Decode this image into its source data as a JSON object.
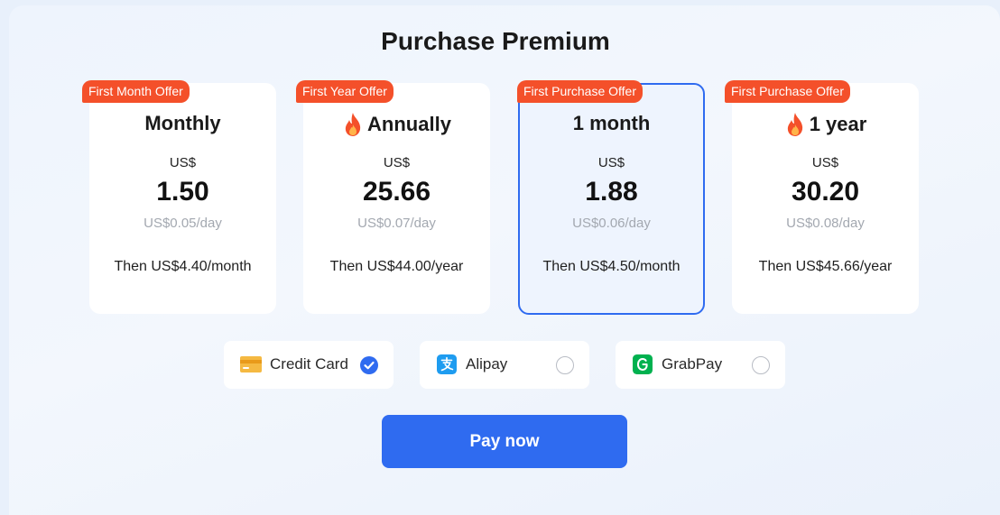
{
  "title": "Purchase Premium",
  "plans": [
    {
      "badge": "First Month Offer",
      "name": "Monthly",
      "hot": false,
      "currency": "US$",
      "price": "1.50",
      "per_day": "US$0.05/day",
      "then": "Then US$4.40/month",
      "selected": false
    },
    {
      "badge": "First Year Offer",
      "name": "Annually",
      "hot": true,
      "currency": "US$",
      "price": "25.66",
      "per_day": "US$0.07/day",
      "then": "Then US$44.00/year",
      "selected": false
    },
    {
      "badge": "First Purchase Offer",
      "name": "1 month",
      "hot": false,
      "currency": "US$",
      "price": "1.88",
      "per_day": "US$0.06/day",
      "then": "Then US$4.50/month",
      "selected": true
    },
    {
      "badge": "First Purchase Offer",
      "name": "1 year",
      "hot": true,
      "currency": "US$",
      "price": "30.20",
      "per_day": "US$0.08/day",
      "then": "Then US$45.66/year",
      "selected": false
    }
  ],
  "payment_methods": [
    {
      "label": "Credit Card",
      "icon": "credit-card-icon",
      "selected": true
    },
    {
      "label": "Alipay",
      "icon": "alipay-icon",
      "selected": false
    },
    {
      "label": "GrabPay",
      "icon": "grabpay-icon",
      "selected": false
    }
  ],
  "pay_button": "Pay now",
  "colors": {
    "accent": "#2f6bf0",
    "badge": "#f4502a",
    "fire": "#f4502a",
    "alipay": "#1e9cf0",
    "grabpay": "#00b14f",
    "card_icon": "#f5b942"
  }
}
